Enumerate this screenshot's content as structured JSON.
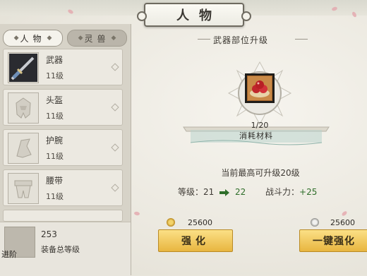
{
  "header": {
    "title": "人物"
  },
  "tabs": [
    {
      "label": "人物",
      "active": true
    },
    {
      "label": "灵兽",
      "active": false
    }
  ],
  "equipment": [
    {
      "name": "武器",
      "level": "11级",
      "icon": "sword-icon"
    },
    {
      "name": "头盔",
      "level": "11级",
      "icon": "helmet-icon"
    },
    {
      "name": "护腕",
      "level": "11级",
      "icon": "bracer-icon"
    },
    {
      "name": "腰带",
      "level": "11级",
      "icon": "belt-icon"
    }
  ],
  "summary": {
    "value": "253",
    "label": "装备总等级"
  },
  "advance_label": "进阶",
  "upgrade": {
    "section_title": "武器部位升级",
    "material_count": "1/20",
    "material_label": "消耗材料",
    "max_level_text": "当前最高可升级20级",
    "level_label": "等级：",
    "level_from": "21",
    "level_to": "22",
    "power_label": "战斗力：",
    "power_delta": "+25"
  },
  "buttons": {
    "enhance": {
      "label": "强化",
      "cost": "25600"
    },
    "enhance_all": {
      "label": "一键强化",
      "cost": "25600"
    }
  },
  "colors": {
    "button": "#f2c85a",
    "gain": "#2f6e2a",
    "material_bg": "#a7662c"
  }
}
